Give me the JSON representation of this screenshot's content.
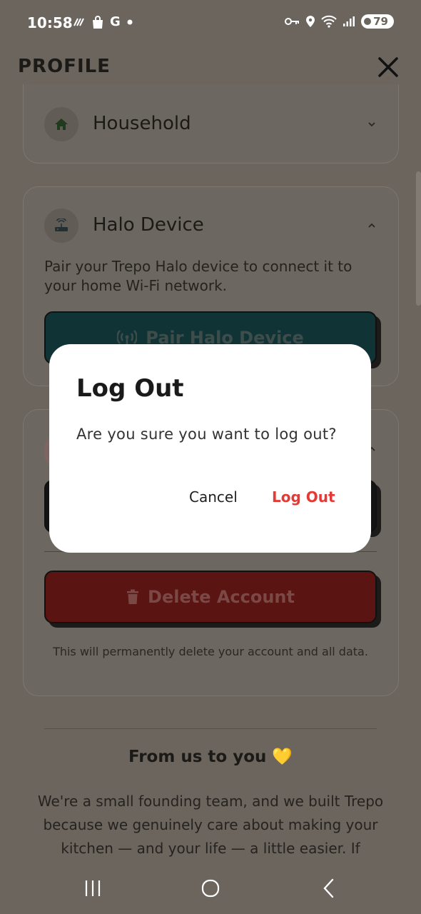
{
  "status_bar": {
    "time": "10:58",
    "left_icons": [
      "stripes-icon",
      "shopping-bag-icon",
      "google-icon",
      "dot-icon"
    ],
    "google_letter": "G",
    "right_icons": [
      "vpn-key-icon",
      "location-icon",
      "wifi-icon",
      "signal-icon"
    ],
    "battery": "79"
  },
  "header": {
    "title": "PROFILE",
    "close_icon": "close-icon"
  },
  "household_card": {
    "title": "Household",
    "icon": "home-icon"
  },
  "halo_card": {
    "title": "Halo Device",
    "icon": "router-icon",
    "description": "Pair your Trepo Halo device to connect it to your home Wi-Fi network.",
    "pair_button": "Pair Halo Device",
    "pair_icon": "wifi-tower-icon"
  },
  "account_card": {
    "delete_button": "Delete Account",
    "delete_icon": "trash-icon",
    "delete_note": "This will permanently delete your account and all data."
  },
  "from_us": {
    "title": "From us to you",
    "heart": "💛",
    "body": "We're a small founding team, and we built Trepo because we genuinely care about making your kitchen — and your life — a little easier. If"
  },
  "dialog": {
    "title": "Log Out",
    "message": "Are you sure you want to log out?",
    "cancel": "Cancel",
    "confirm": "Log Out"
  },
  "nav_bar": {
    "recents": "recents-icon",
    "home": "home-circle-icon",
    "back": "back-icon"
  },
  "colors": {
    "scrim": "#6b655e",
    "accent_red": "#e53935",
    "dialog_bg": "#ffffff"
  }
}
